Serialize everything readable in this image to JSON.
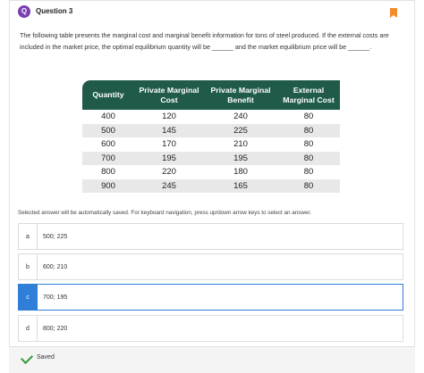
{
  "question": {
    "title": "Question 3",
    "prompt": "The following table presents the marginal cost and marginal benefit information for tons of steel produced.  If the external costs are included in the market price, the optimal equilibrium quantity will be ______ and the market equilibrium price will be ______."
  },
  "table": {
    "headers": [
      "Quantity",
      "Private Marginal Cost",
      "Private Marginal Benefit",
      "External Marginal Cost"
    ],
    "rows": [
      [
        "400",
        "120",
        "240",
        "80"
      ],
      [
        "500",
        "145",
        "225",
        "80"
      ],
      [
        "600",
        "170",
        "210",
        "80"
      ],
      [
        "700",
        "195",
        "195",
        "80"
      ],
      [
        "800",
        "220",
        "180",
        "80"
      ],
      [
        "900",
        "245",
        "165",
        "80"
      ]
    ]
  },
  "note": "Selected answer will be automatically saved. For keyboard navigation, press up/down arrow keys to select an answer.",
  "options": [
    {
      "letter": "a",
      "text": "500; 225"
    },
    {
      "letter": "b",
      "text": "600; 210"
    },
    {
      "letter": "c",
      "text": "700; 195"
    },
    {
      "letter": "d",
      "text": "800; 220"
    }
  ],
  "selected_option": "c",
  "status": {
    "saved_label": "Saved"
  },
  "colors": {
    "accent": "#2f7ed8",
    "table_header": "#1f5a4b",
    "bookmark": "#f28c28",
    "question_icon": "#7b3fb3",
    "saved_check": "#3a9a3a"
  }
}
